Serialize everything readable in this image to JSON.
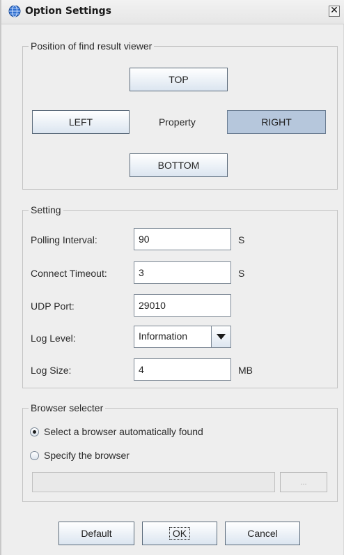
{
  "window": {
    "title": "Option Settings",
    "close_glyph": "✕",
    "icon": "globe-icon"
  },
  "position_group": {
    "title": "Position of find result  viewer",
    "top_label": "TOP",
    "left_label": "LEFT",
    "center_label": "Property",
    "right_label": "RIGHT",
    "bottom_label": "BOTTOM",
    "selected": "RIGHT"
  },
  "setting_group": {
    "title": "Setting",
    "polling_label": "Polling Interval:",
    "polling_value": "90",
    "polling_unit": "S",
    "timeout_label": "Connect Timeout:",
    "timeout_value": "3",
    "timeout_unit": "S",
    "udp_label": "UDP Port:",
    "udp_value": "29010",
    "log_level_label": "Log Level:",
    "log_level_value": "Information",
    "log_size_label": "Log Size:",
    "log_size_value": "4",
    "log_size_unit": "MB"
  },
  "browser_group": {
    "title": "Browser selecter",
    "auto_label": "Select a browser automatically found",
    "specify_label": "Specify the browser",
    "path_value": "",
    "browse_label": "...",
    "selected": "auto"
  },
  "footer": {
    "default_label": "Default",
    "ok_label": "OK",
    "cancel_label": "Cancel"
  },
  "colors": {
    "selected_button": "#b6c7dc",
    "button_border": "#5a6a7a",
    "dialog_bg": "#eeeeee"
  }
}
